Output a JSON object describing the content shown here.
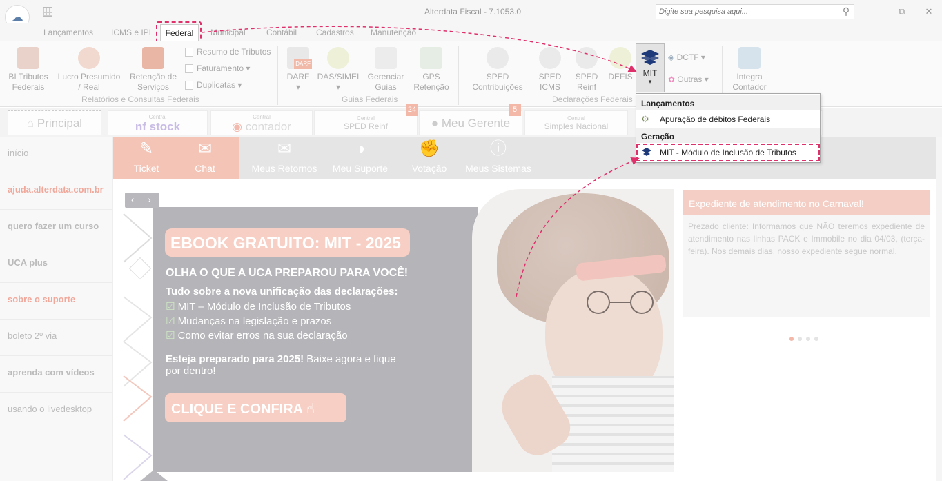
{
  "app": {
    "title": "Alterdata Fiscal - 7.1053.0",
    "search_placeholder": "Digite sua pesquisa aqui..."
  },
  "menu_tabs": [
    {
      "label": "Lançamentos"
    },
    {
      "label": "ICMS e IPI"
    },
    {
      "label": "Federal",
      "active": true
    },
    {
      "label": "Municipal"
    },
    {
      "label": "Contábil"
    },
    {
      "label": "Cadastros"
    },
    {
      "label": "Manutenção"
    }
  ],
  "ribbon": {
    "bi_tributos": "BI Tributos\nFederais",
    "lucro_presumido": "Lucro Presumido\n/ Real",
    "retencao_servicos": "Retenção de\nServiços",
    "resumo_tributos": "Resumo de Tributos",
    "faturamento": "Faturamento",
    "duplicatas": "Duplicatas",
    "group_relatorios": "Relatórios e Consultas Federais",
    "darf": "DARF",
    "darf_tag": "DARF",
    "das_simei": "DAS/SIMEI",
    "gerenciar_guias": "Gerenciar\nGuias",
    "gps_retencao": "GPS\nRetenção",
    "group_guias": "Guias Federais",
    "sped_contribuicoes": "SPED\nContribuições",
    "sped_icms": "SPED\nICMS",
    "sped_reinf": "SPED\nReinf",
    "defis": "DEFIS",
    "mit": "MIT",
    "dctf": "DCTF",
    "outras": "Outras",
    "integra_contador": "Integra\nContador",
    "group_declaracoes": "Declarações Federais"
  },
  "dropdown": {
    "section1": "Lançamentos",
    "item1": "Apuração de débitos Federais",
    "section2": "Geração",
    "item2": "MIT - Módulo de Inclusão de Tributos"
  },
  "strip": {
    "principal": "Principal",
    "nfstock_small": "Central",
    "nfstock": "nf stock",
    "contador_small": "Central",
    "contador": "contador",
    "spedreinf_small": "Central",
    "spedreinf": "SPED Reinf",
    "meu_gerente": "Meu Gerente",
    "simples_small": "Central",
    "simples": "Simples Nacional",
    "badge1": "24",
    "badge2": "5"
  },
  "sidebar": [
    {
      "label": "início"
    },
    {
      "label": "ajuda.alterdata.com.br"
    },
    {
      "label": "quero fazer um curso"
    },
    {
      "label": "UCA plus"
    },
    {
      "label": "sobre o suporte"
    },
    {
      "label": "boleto 2º via"
    },
    {
      "label": "aprenda com vídeos"
    },
    {
      "label": "usando o livedesktop"
    }
  ],
  "support": {
    "ticket": "Ticket",
    "chat": "Chat",
    "meus_retornos": "Meus Retornos",
    "meu_suporte": "Meu Suporte",
    "votacao": "Votação",
    "meus_sistemas": "Meus Sistemas"
  },
  "banner": {
    "title": "EBOOK GRATUITO: MIT - 2025",
    "subtitle": "OLHA O QUE A UCA PREPAROU PARA VOCÊ!",
    "intro": "Tudo sobre a nova unificação das declarações:",
    "bullets": [
      "MIT – Módulo de Inclusão de Tributos",
      "Mudanças na legislação e prazos",
      "Como evitar erros na sua declaração"
    ],
    "closing_bold": "Esteja preparado para 2025!",
    "closing_rest": " Baixe agora e fique",
    "closing_line2": "por dentro!",
    "cta": "CLIQUE E CONFIRA"
  },
  "news": {
    "title": "Expediente de atendimento no Carnaval!",
    "body": "Prezado cliente: Informamos que NÃO teremos expediente de atendimento nas linhas PACK e Immobile no dia 04/03, (terça-feira). Nos demais dias, nosso expediente segue normal."
  },
  "colors": {
    "highlight": "#e0306c",
    "accent_peach": "#f4c4b6",
    "banner_gray": "#b5b5b9"
  }
}
